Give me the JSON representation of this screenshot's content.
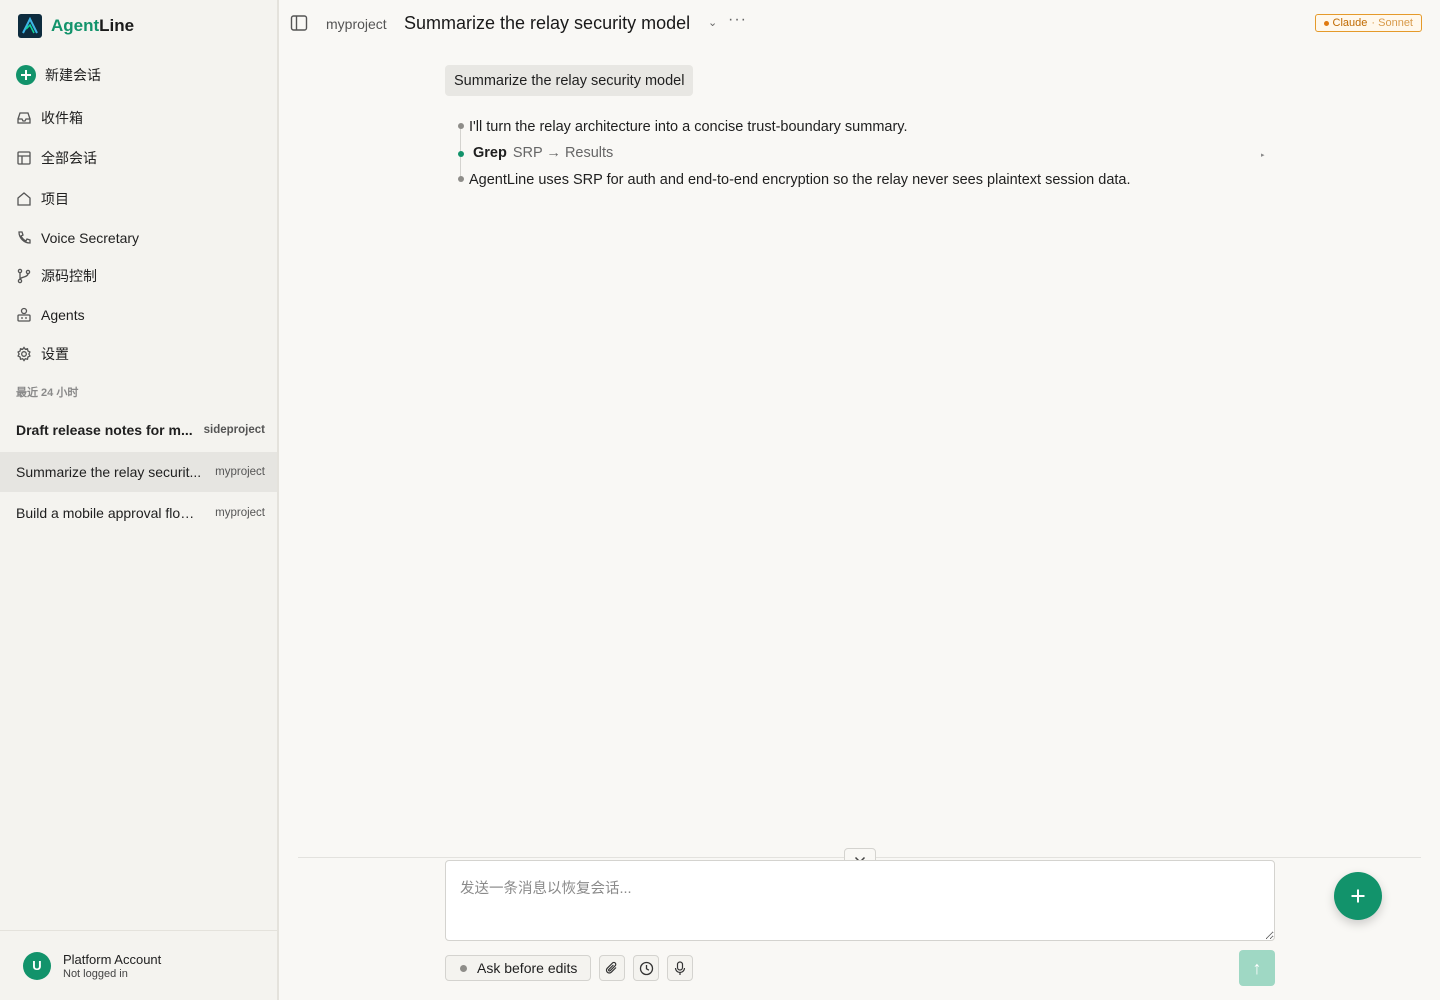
{
  "brand": {
    "name_prefix": "Agent",
    "name_suffix": "Line"
  },
  "sidebar": {
    "new_chat": "新建会话",
    "items": [
      {
        "label": "收件箱",
        "icon": "inbox-icon"
      },
      {
        "label": "全部会话",
        "icon": "layout-icon"
      },
      {
        "label": "项目",
        "icon": "home-icon"
      },
      {
        "label": "Voice Secretary",
        "icon": "phone-icon"
      },
      {
        "label": "源码控制",
        "icon": "git-branch-icon"
      },
      {
        "label": "Agents",
        "icon": "robot-icon"
      },
      {
        "label": "设置",
        "icon": "gear-icon"
      }
    ],
    "recent_label": "最近 24 小时",
    "recent": [
      {
        "title": "Draft release notes for m...",
        "project": "sideproject"
      },
      {
        "title": "Summarize the relay securit...",
        "project": "myproject"
      },
      {
        "title": "Build a mobile approval flow ...",
        "project": "myproject"
      }
    ]
  },
  "account": {
    "initial": "U",
    "name": "Platform Account",
    "status": "Not logged in"
  },
  "header": {
    "project": "myproject",
    "title": "Summarize the relay security model",
    "more": "···",
    "model_name": "Claude",
    "model_variant": "· Sonnet"
  },
  "conversation": {
    "user_message": "Summarize the relay security model",
    "assistant_intro": "I'll turn the relay architecture into a concise trust-boundary summary.",
    "tool_name": "Grep",
    "tool_args": "SRP → Results",
    "assistant_result": "AgentLine uses SRP for auth and end-to-end encryption so the relay never sees plaintext session data."
  },
  "composer": {
    "placeholder": "发送一条消息以恢复会话...",
    "mode_label": "Ask before edits",
    "send_symbol": "↑"
  },
  "colors": {
    "accent": "#12936b",
    "model_badge": "#e59a2a"
  }
}
